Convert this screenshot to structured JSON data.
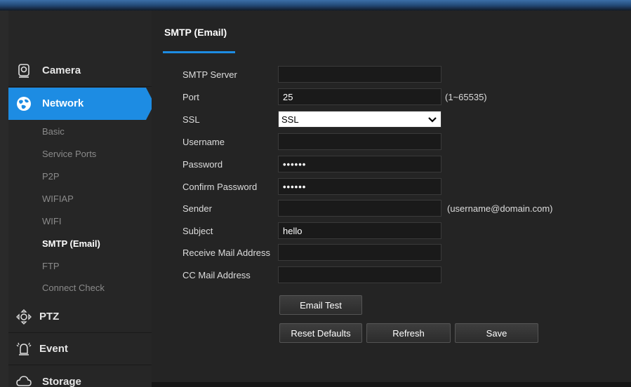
{
  "sidebar": {
    "sections": {
      "camera": {
        "label": "Camera",
        "icon": "camera-icon"
      },
      "network": {
        "label": "Network",
        "icon": "globe-icon"
      },
      "ptz": {
        "label": "PTZ",
        "icon": "ptz-icon"
      },
      "event": {
        "label": "Event",
        "icon": "alarm-icon"
      },
      "storage": {
        "label": "Storage",
        "icon": "cloud-icon"
      }
    },
    "network_items": [
      {
        "label": "Basic"
      },
      {
        "label": "Service Ports"
      },
      {
        "label": "P2P"
      },
      {
        "label": "WIFIAP"
      },
      {
        "label": "WIFI"
      },
      {
        "label": "SMTP (Email)"
      },
      {
        "label": "FTP"
      },
      {
        "label": "Connect Check"
      }
    ]
  },
  "main": {
    "tab": "SMTP (Email)",
    "form": {
      "smtp_server": {
        "label": "SMTP Server",
        "value": ""
      },
      "port": {
        "label": "Port",
        "value": "25",
        "hint": "(1~65535)"
      },
      "ssl": {
        "label": "SSL",
        "value": "SSL"
      },
      "username": {
        "label": "Username",
        "value": ""
      },
      "password": {
        "label": "Password",
        "value": "••••••"
      },
      "confirm_password": {
        "label": "Confirm Password",
        "value": "••••••"
      },
      "sender": {
        "label": "Sender",
        "value": "",
        "hint": "(username@domain.com)"
      },
      "subject": {
        "label": "Subject",
        "value": "hello"
      },
      "receive_mail": {
        "label": "Receive Mail Address",
        "value": ""
      },
      "cc_mail": {
        "label": "CC Mail Address",
        "value": ""
      }
    },
    "buttons": {
      "email_test": "Email Test",
      "reset_defaults": "Reset Defaults",
      "refresh": "Refresh",
      "save": "Save"
    }
  },
  "colors": {
    "accent": "#1d8ce3",
    "background": "#242424",
    "sidebar": "#262626"
  }
}
